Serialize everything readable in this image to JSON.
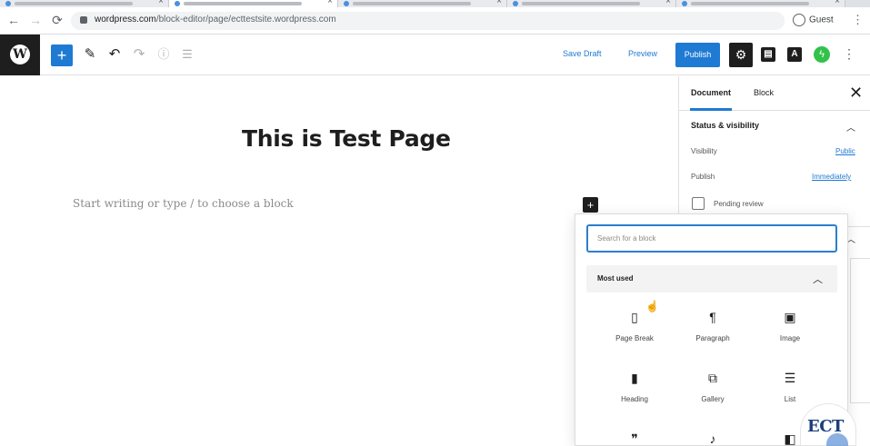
{
  "browser": {
    "url_host": "wordpress.com",
    "url_path": "/block-editor/page/ecttestsite.wordpress.com",
    "profile_label": "Guest"
  },
  "toolbar": {
    "save_draft_label": "Save Draft",
    "preview_label": "Preview",
    "publish_label": "Publish",
    "astra_label": "A",
    "accent_color": "#1f7ad3"
  },
  "editor": {
    "title": "This is Test Page",
    "placeholder": "Start writing or type / to choose a block"
  },
  "sidebar": {
    "tabs": [
      "Document",
      "Block"
    ],
    "panel_title": "Status & visibility",
    "visibility_label": "Visibility",
    "visibility_value": "Public",
    "publish_label": "Publish",
    "publish_value": "Immediately",
    "pending_review_label": "Pending review"
  },
  "inserter": {
    "search_placeholder": "Search for a block",
    "section_label": "Most used",
    "blocks": [
      {
        "name": "Page Break",
        "icon": "page-break-icon"
      },
      {
        "name": "Paragraph",
        "icon": "paragraph-icon"
      },
      {
        "name": "Image",
        "icon": "image-icon"
      },
      {
        "name": "Heading",
        "icon": "heading-icon"
      },
      {
        "name": "Gallery",
        "icon": "gallery-icon"
      },
      {
        "name": "List",
        "icon": "list-icon"
      }
    ]
  },
  "watermark": {
    "text": "ECT"
  }
}
